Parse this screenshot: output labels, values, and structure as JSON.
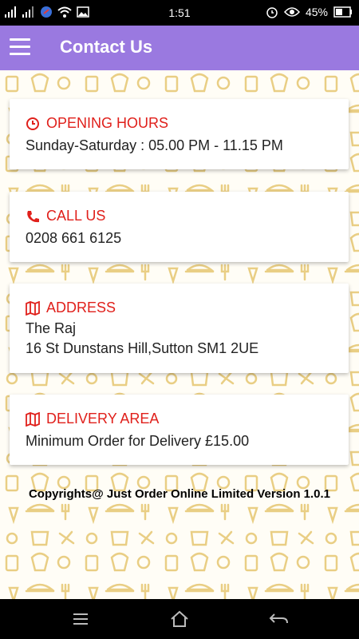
{
  "status_bar": {
    "time": "1:51",
    "battery": "45%",
    "icons": [
      "signal-icon",
      "signal-icon",
      "usb-icon",
      "wifi-icon",
      "image-icon",
      "alarm-icon",
      "eye-icon",
      "battery-icon"
    ]
  },
  "app_bar": {
    "title": "Contact Us",
    "menu_icon": "hamburger-icon"
  },
  "cards": {
    "opening_hours": {
      "heading": "OPENING HOURS",
      "icon": "clock-icon",
      "line1": "Sunday-Saturday : 05.00 PM - 11.15 PM"
    },
    "call_us": {
      "heading": "CALL US",
      "icon": "phone-icon",
      "line1": "0208 661 6125"
    },
    "address": {
      "heading": "ADDRESS",
      "icon": "map-icon",
      "line1": "The Raj",
      "line2": "16 St Dunstans Hill,Sutton SM1 2UE"
    },
    "delivery_area": {
      "heading": "DELIVERY AREA",
      "icon": "map-icon",
      "line1": "Minimum Order for Delivery £15.00"
    }
  },
  "footer": {
    "text": "Copyrights@ Just Order Online Limited Version 1.0.1"
  },
  "nav_bar": {
    "items": [
      "menu-lines-icon",
      "home-icon",
      "back-icon"
    ]
  },
  "colors": {
    "accent": "#9a79e0",
    "heading_red": "#e0201b",
    "pattern": "#e7c977"
  }
}
